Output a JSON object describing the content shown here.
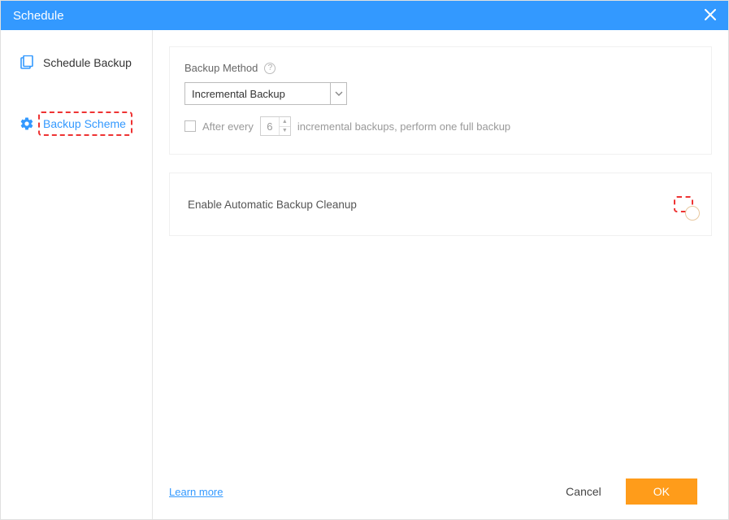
{
  "window": {
    "title": "Schedule"
  },
  "sidebar": {
    "items": [
      {
        "label": "Schedule Backup",
        "icon": "calendar-icon"
      },
      {
        "label": "Backup Scheme",
        "icon": "gear-icon"
      }
    ]
  },
  "backup_method": {
    "label": "Backup Method",
    "selected": "Incremental Backup",
    "after_every_checked": false,
    "after_every_label_pre": "After every",
    "after_every_value": "6",
    "after_every_label_post": "incremental backups, perform one full backup"
  },
  "cleanup": {
    "label": "Enable Automatic Backup Cleanup",
    "enabled": false
  },
  "footer": {
    "learn_more": "Learn more",
    "cancel": "Cancel",
    "ok": "OK"
  }
}
